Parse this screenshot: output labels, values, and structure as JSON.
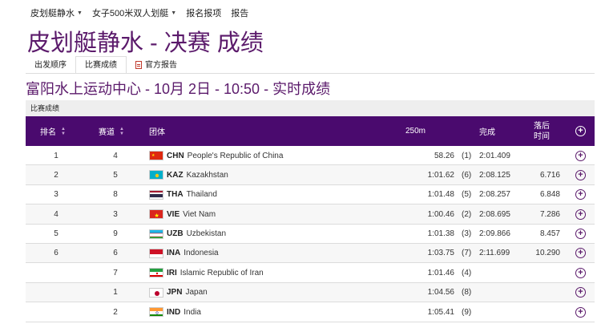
{
  "topnav": [
    {
      "label": "皮划艇静水",
      "caret": true
    },
    {
      "label": "女子500米双人划艇",
      "caret": true
    },
    {
      "label": "报名报项",
      "caret": false
    },
    {
      "label": "报告",
      "caret": false
    }
  ],
  "title": "皮划艇静水 - 决赛 成绩",
  "tabs": [
    {
      "label": "出发顺序"
    },
    {
      "label": "比赛成绩"
    },
    {
      "label": "官方报告"
    }
  ],
  "subtitle": "富阳水上运动中心 - 10月 2日 - 10:50 - 实时成绩",
  "section_label": "比赛成绩",
  "headers": {
    "rank": "排名",
    "lane": "赛道",
    "team": "团体",
    "split": "250m",
    "finish": "完成",
    "behind_line1": "落后",
    "behind_line2": "时间"
  },
  "rows": [
    {
      "rank": "1",
      "lane": "4",
      "flag": "flag-china",
      "code": "CHN",
      "name": "People's Republic of China",
      "split": "58.26",
      "split_rank": "(1)",
      "finish": "2:01.409",
      "behind": ""
    },
    {
      "rank": "2",
      "lane": "5",
      "flag": "flag-kazakhstan",
      "code": "KAZ",
      "name": "Kazakhstan",
      "split": "1:01.62",
      "split_rank": "(6)",
      "finish": "2:08.125",
      "behind": "6.716"
    },
    {
      "rank": "3",
      "lane": "8",
      "flag": "flag-thailand",
      "code": "THA",
      "name": "Thailand",
      "split": "1:01.48",
      "split_rank": "(5)",
      "finish": "2:08.257",
      "behind": "6.848"
    },
    {
      "rank": "4",
      "lane": "3",
      "flag": "flag-vietnam",
      "code": "VIE",
      "name": "Viet Nam",
      "split": "1:00.46",
      "split_rank": "(2)",
      "finish": "2:08.695",
      "behind": "7.286"
    },
    {
      "rank": "5",
      "lane": "9",
      "flag": "flag-uzbekistan",
      "code": "UZB",
      "name": "Uzbekistan",
      "split": "1:01.38",
      "split_rank": "(3)",
      "finish": "2:09.866",
      "behind": "8.457"
    },
    {
      "rank": "6",
      "lane": "6",
      "flag": "flag-indonesia",
      "code": "INA",
      "name": "Indonesia",
      "split": "1:03.75",
      "split_rank": "(7)",
      "finish": "2:11.699",
      "behind": "10.290"
    },
    {
      "rank": "",
      "lane": "7",
      "flag": "flag-iran",
      "code": "IRI",
      "name": "Islamic Republic of Iran",
      "split": "1:01.46",
      "split_rank": "(4)",
      "finish": "",
      "behind": ""
    },
    {
      "rank": "",
      "lane": "1",
      "flag": "flag-japan",
      "code": "JPN",
      "name": "Japan",
      "split": "1:04.56",
      "split_rank": "(8)",
      "finish": "",
      "behind": ""
    },
    {
      "rank": "",
      "lane": "2",
      "flag": "flag-india",
      "code": "IND",
      "name": "India",
      "split": "1:05.41",
      "split_rank": "(9)",
      "finish": "",
      "behind": ""
    }
  ],
  "colors": {
    "brand": "#5b1a6b",
    "header_bg": "#4a0a6e"
  }
}
